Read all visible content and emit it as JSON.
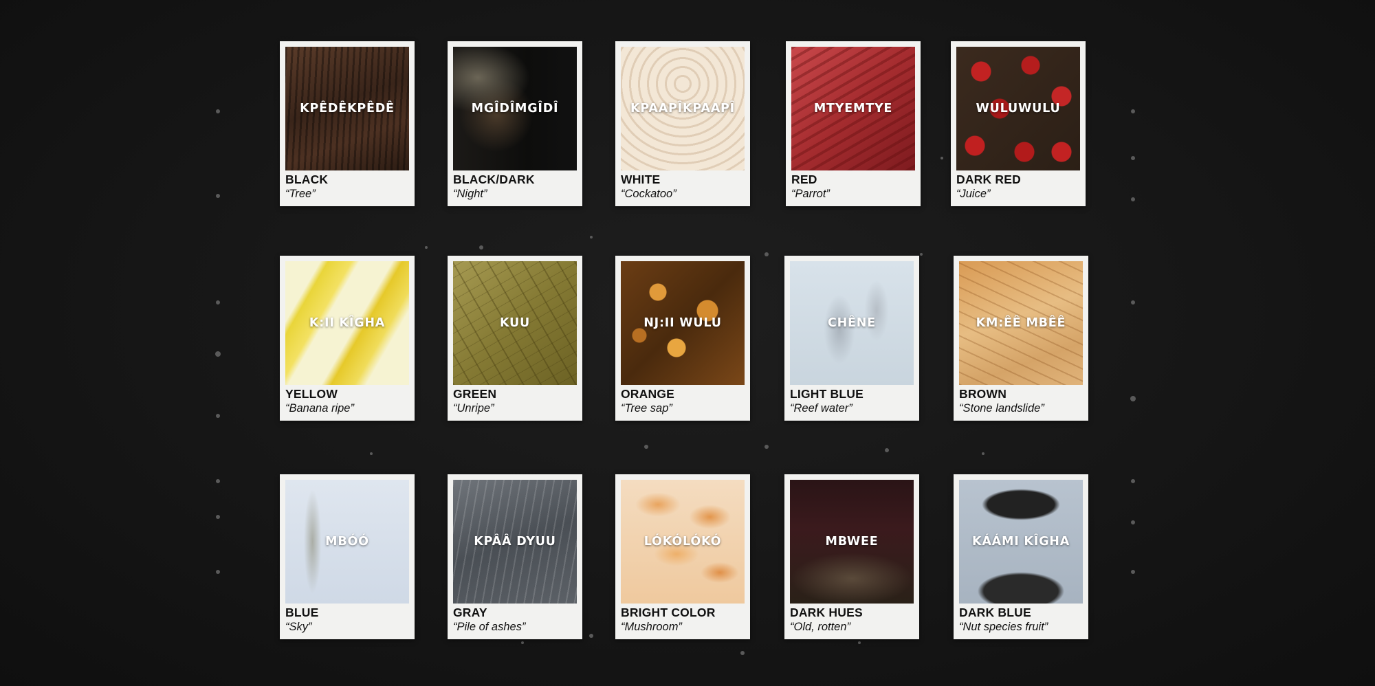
{
  "cards": [
    {
      "word": "KPÊDÊKPÊDÊ",
      "color": "BLACK",
      "meaning": "“Tree”"
    },
    {
      "word": "MGÎDÎMGÎDÎ",
      "color": "BLACK/DARK",
      "meaning": "“Night”"
    },
    {
      "word": "KPAAPÎKPAAPÎ",
      "color": "WHITE",
      "meaning": "“Cockatoo”"
    },
    {
      "word": "MTYEMTYE",
      "color": "RED",
      "meaning": "“Parrot”"
    },
    {
      "word": "WULUWULU",
      "color": "DARK RED",
      "meaning": "“Juice”"
    },
    {
      "word": "K:II KÎGHA",
      "color": "YELLOW",
      "meaning": "“Banana ripe”"
    },
    {
      "word": "KUU",
      "color": "GREEN",
      "meaning": "“Unripe”"
    },
    {
      "word": "NJ:II WULU",
      "color": "ORANGE",
      "meaning": "“Tree sap”"
    },
    {
      "word": "CHÊNE",
      "color": "LIGHT BLUE",
      "meaning": "“Reef water”"
    },
    {
      "word": "KM:ÊÊ MBÊÊ",
      "color": "BROWN",
      "meaning": "“Stone landslide”"
    },
    {
      "word": "MBÓÓ",
      "color": "BLUE",
      "meaning": "“Sky”"
    },
    {
      "word": "KPÂÂ DYUU",
      "color": "GRAY",
      "meaning": "“Pile of ashes”"
    },
    {
      "word": "LÓKÓLÓKÓ",
      "color": "BRIGHT COLOR",
      "meaning": "“Mushroom”"
    },
    {
      "word": "MBWEE",
      "color": "DARK HUES",
      "meaning": "“Old, rotten”"
    },
    {
      "word": "KÁÁMI KÎGHA",
      "color": "DARK BLUE",
      "meaning": "“Nut species fruit”"
    }
  ]
}
